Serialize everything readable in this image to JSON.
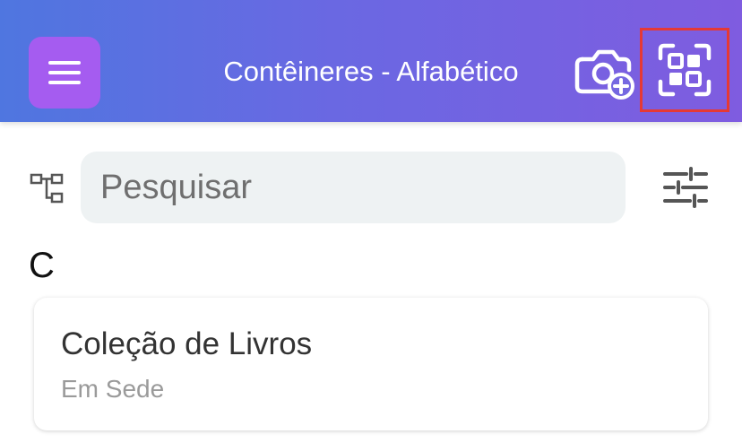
{
  "header": {
    "title": "Contêineres - Alfabético",
    "menu_icon": "hamburger-menu-icon",
    "camera_icon": "camera-add-icon",
    "scan_icon": "qr-scan-icon",
    "gradient_start": "#4f76e0",
    "gradient_end": "#7f5ce0",
    "menu_button_color": "#a55cf0",
    "highlight_color": "#e53935"
  },
  "search": {
    "placeholder": "Pesquisar",
    "value": "",
    "tree_icon": "hierarchy-tree-icon",
    "filter_icon": "filter-sliders-icon"
  },
  "list": {
    "sections": [
      {
        "letter": "C",
        "items": [
          {
            "title": "Coleção de Livros",
            "subtitle": "Em Sede"
          }
        ]
      }
    ]
  }
}
